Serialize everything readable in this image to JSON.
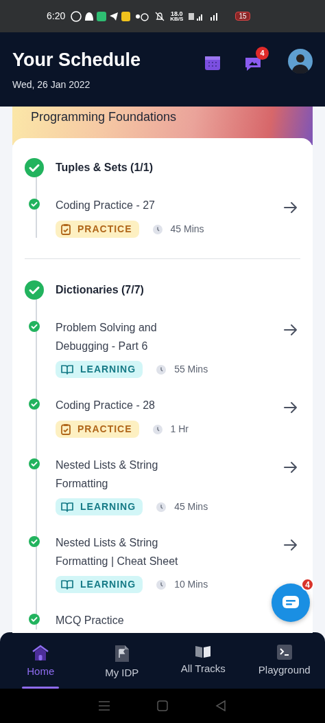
{
  "status_bar": {
    "time": "6:20",
    "net_speed": "18.0",
    "net_unit": "KB/S",
    "battery": "15"
  },
  "header": {
    "title": "Your Schedule",
    "date": "Wed, 26 Jan 2022",
    "notification_count": "4"
  },
  "course": {
    "title": "Programming Foundations"
  },
  "sections": [
    {
      "title": "Tuples & Sets (1/1)",
      "done": true,
      "items": [
        {
          "title": "Coding Practice - 27",
          "done": true,
          "kind": "practice",
          "badge": "PRACTICE",
          "duration": "45 Mins"
        }
      ]
    },
    {
      "title": "Dictionaries (7/7)",
      "done": true,
      "items": [
        {
          "title": "Problem Solving and Debugging - Part 6",
          "done": true,
          "kind": "learning",
          "badge": "LEARNING",
          "duration": "55 Mins"
        },
        {
          "title": "Coding Practice - 28",
          "done": true,
          "kind": "practice",
          "badge": "PRACTICE",
          "duration": "1 Hr"
        },
        {
          "title": "Nested Lists & String Formatting",
          "done": true,
          "kind": "learning",
          "badge": "LEARNING",
          "duration": "45 Mins"
        },
        {
          "title": "Nested Lists & String Formatting | Cheat Sheet",
          "done": true,
          "kind": "learning",
          "badge": "LEARNING",
          "duration": "10 Mins"
        },
        {
          "title": "MCQ Practice",
          "done": true
        }
      ]
    }
  ],
  "chat_button": {
    "count": "4"
  },
  "bottom_nav": [
    {
      "label": "Home",
      "selected": true
    },
    {
      "label": "My IDP",
      "selected": false
    },
    {
      "label": "All Tracks",
      "selected": false
    },
    {
      "label": "Playground",
      "selected": false
    }
  ]
}
